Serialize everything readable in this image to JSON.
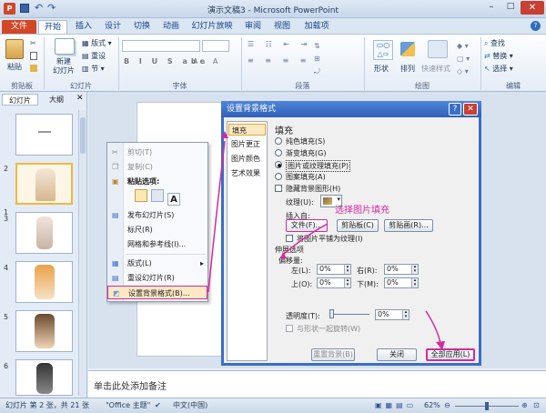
{
  "window": {
    "title": "演示文稿3 - Microsoft PowerPoint"
  },
  "tabs": [
    "文件",
    "开始",
    "插入",
    "设计",
    "切换",
    "动画",
    "幻灯片放映",
    "审阅",
    "视图",
    "加载项"
  ],
  "ribbon": {
    "groups": [
      "剪贴板",
      "幻灯片",
      "字体",
      "段落",
      "绘图",
      "编辑"
    ],
    "paste": "粘贴",
    "new_slide": "新建\n幻灯片",
    "layout": "版式",
    "reset": "重设",
    "section": "节",
    "shape": "形状",
    "arrange": "排列",
    "quick_style": "快速样式",
    "find": "查找",
    "replace": "替换",
    "select": "选择"
  },
  "left_pane": {
    "tab_slides": "幻灯片",
    "tab_outline": "大纲",
    "slide_numbers": [
      "1",
      "2",
      "3",
      "4",
      "5",
      "6"
    ]
  },
  "context_menu": {
    "items": [
      "剪切(T)",
      "复制(C)",
      "粘贴选项:",
      "发布幻灯片(S)",
      "标尺(R)",
      "网格和参考线(I)...",
      "版式(L)",
      "重设幻灯片(R)",
      "设置背景格式(B)..."
    ]
  },
  "dialog": {
    "title": "设置背景格式",
    "nav": [
      "填充",
      "图片更正",
      "图片颜色",
      "艺术效果"
    ],
    "section_title": "填充",
    "fill_options": [
      "纯色填充(S)",
      "渐变填充(G)",
      "图片或纹理填充(P)",
      "图案填充(A)"
    ],
    "hide_bg": "隐藏背景图形(H)",
    "texture_label": "纹理(U):",
    "insert_from": "插入自:",
    "file_btn": "文件(F)...",
    "clipboard_btn": "剪贴板(C)",
    "clipart_btn": "剪贴画(R)...",
    "annotation": "选择图片填充",
    "tile": "将图片平铺为纹理(I)",
    "stretch": "伸展选项",
    "offset": "偏移量:",
    "left_label": "左(L):",
    "right_label": "右(R):",
    "top_label": "上(O):",
    "bottom_label": "下(M):",
    "left_val": "0%",
    "right_val": "0%",
    "top_val": "0%",
    "bottom_val": "0%",
    "transparency": "透明度(T):",
    "transparency_val": "0%",
    "rotate_with_shape": "与形状一起旋转(W)",
    "reset_bg": "重置背景(B)",
    "close": "关闭",
    "apply_all": "全部应用(L)"
  },
  "notes": {
    "placeholder": "单击此处添加备注"
  },
  "status": {
    "slide_info": "幻灯片 第 2 张，共 21 张",
    "theme": "\"Office 主题\"",
    "lang": "中文(中国)",
    "zoom": "62%"
  },
  "colors": {
    "accent_file_tab": "#d24726",
    "highlight_magenta": "#d42aa0",
    "dialog_border": "#3a6ec8"
  }
}
